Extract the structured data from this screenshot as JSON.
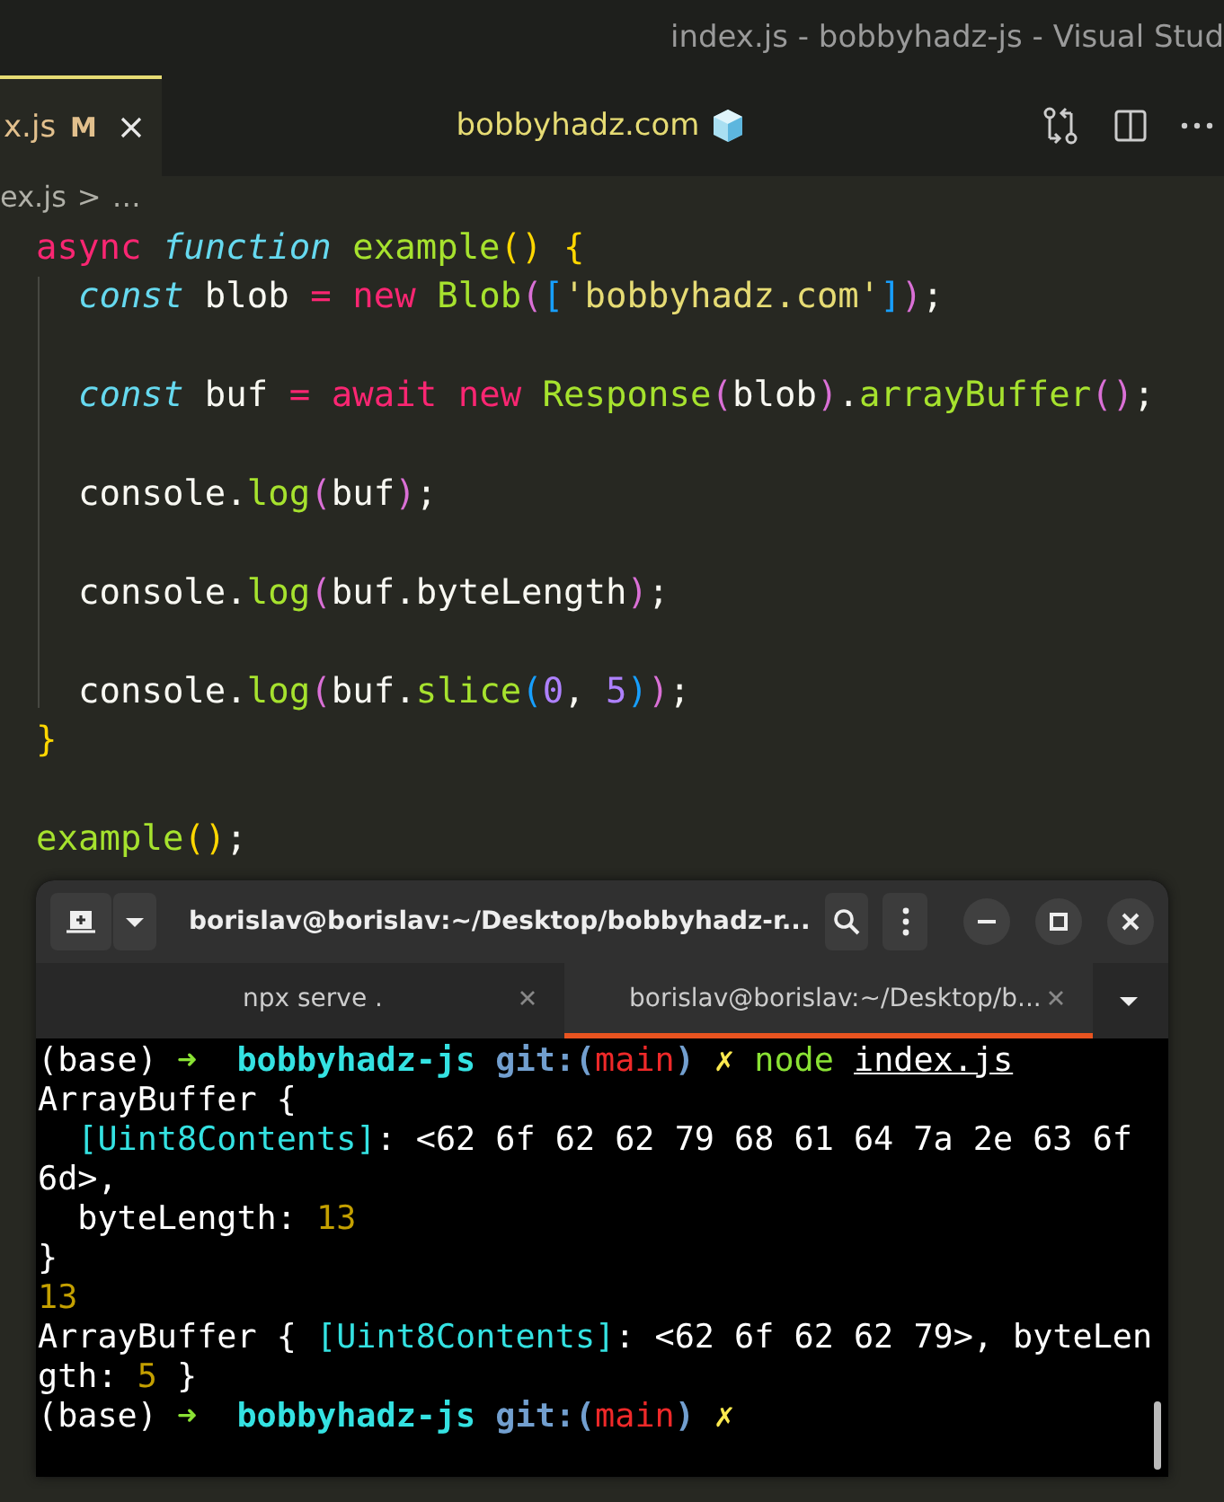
{
  "window": {
    "title": "index.js - bobbyhadz-js - Visual Stud"
  },
  "editor_tabs": [
    {
      "label": "x.js",
      "badge": "M",
      "selected": true
    }
  ],
  "editor_title": {
    "text": "bobbyhadz.com"
  },
  "breadcrumb": {
    "file": "ex.js",
    "separator": ">",
    "rest": "…"
  },
  "code_lines": [
    {
      "spaced": false,
      "tokens": [
        {
          "text": "async",
          "kind": "kw"
        },
        {
          "text": " function",
          "kind": "storage"
        },
        {
          "text": " example",
          "kind": "fn"
        },
        {
          "text": "()",
          "kind": "p1"
        },
        {
          "text": " {",
          "kind": "p1"
        }
      ]
    },
    {
      "spaced": false,
      "tokens": [
        {
          "text": "  const",
          "kind": "storage"
        },
        {
          "text": " blob ",
          "kind": "plain"
        },
        {
          "text": "=",
          "kind": "kw"
        },
        {
          "text": " new",
          "kind": "kw"
        },
        {
          "text": " Blob",
          "kind": "fn"
        },
        {
          "text": "(",
          "kind": "p2"
        },
        {
          "text": "[",
          "kind": "p3"
        },
        {
          "text": "'bobbyhadz.com'",
          "kind": "str"
        },
        {
          "text": "]",
          "kind": "p3"
        },
        {
          "text": ")",
          "kind": "p2"
        },
        {
          "text": ";",
          "kind": "plain"
        }
      ]
    },
    {
      "spaced": true,
      "tokens": [
        {
          "text": "  const",
          "kind": "storage"
        },
        {
          "text": " buf ",
          "kind": "plain"
        },
        {
          "text": "=",
          "kind": "kw"
        },
        {
          "text": " await",
          "kind": "kw"
        },
        {
          "text": " new",
          "kind": "kw"
        },
        {
          "text": " Response",
          "kind": "fn"
        },
        {
          "text": "(",
          "kind": "p2"
        },
        {
          "text": "blob",
          "kind": "plain"
        },
        {
          "text": ")",
          "kind": "p2"
        },
        {
          "text": ".",
          "kind": "plain"
        },
        {
          "text": "arrayBuffer",
          "kind": "fn"
        },
        {
          "text": "()",
          "kind": "p2"
        },
        {
          "text": ";",
          "kind": "plain"
        }
      ]
    },
    {
      "spaced": true,
      "tokens": [
        {
          "text": "  console.",
          "kind": "plain"
        },
        {
          "text": "log",
          "kind": "fn"
        },
        {
          "text": "(",
          "kind": "p2"
        },
        {
          "text": "buf",
          "kind": "plain"
        },
        {
          "text": ")",
          "kind": "p2"
        },
        {
          "text": ";",
          "kind": "plain"
        }
      ]
    },
    {
      "spaced": true,
      "tokens": [
        {
          "text": "  console.",
          "kind": "plain"
        },
        {
          "text": "log",
          "kind": "fn"
        },
        {
          "text": "(",
          "kind": "p2"
        },
        {
          "text": "buf.byteLength",
          "kind": "plain"
        },
        {
          "text": ")",
          "kind": "p2"
        },
        {
          "text": ";",
          "kind": "plain"
        }
      ]
    },
    {
      "spaced": true,
      "tokens": [
        {
          "text": "  console.",
          "kind": "plain"
        },
        {
          "text": "log",
          "kind": "fn"
        },
        {
          "text": "(",
          "kind": "p2"
        },
        {
          "text": "buf.",
          "kind": "plain"
        },
        {
          "text": "slice",
          "kind": "fn"
        },
        {
          "text": "(",
          "kind": "p3"
        },
        {
          "text": "0",
          "kind": "num"
        },
        {
          "text": ", ",
          "kind": "plain"
        },
        {
          "text": "5",
          "kind": "num"
        },
        {
          "text": ")",
          "kind": "p3"
        },
        {
          "text": ")",
          "kind": "p2"
        },
        {
          "text": ";",
          "kind": "plain"
        }
      ]
    },
    {
      "spaced": false,
      "tokens": [
        {
          "text": "}",
          "kind": "p1"
        }
      ]
    },
    {
      "spaced": true,
      "tokens": [
        {
          "text": "example",
          "kind": "fn"
        },
        {
          "text": "()",
          "kind": "p1"
        },
        {
          "text": ";",
          "kind": "plain"
        }
      ]
    }
  ],
  "terminal": {
    "title": "borislav@borislav:~/Desktop/bobbyhadz-r...",
    "tabs": [
      {
        "label": "npx serve .",
        "selected": false
      },
      {
        "label": "borislav@borislav:~/Desktop/b...",
        "selected": true
      }
    ],
    "lines": [
      [
        {
          "text": "(base) ",
          "kind": "plain"
        },
        {
          "text": "➜",
          "kind": "arrow"
        },
        {
          "text": "  bobbyhadz-js",
          "kind": "dir"
        },
        {
          "text": " git:(",
          "kind": "git"
        },
        {
          "text": "main",
          "kind": "branch"
        },
        {
          "text": ")",
          "kind": "git"
        },
        {
          "text": " ✗",
          "kind": "x"
        },
        {
          "text": " node ",
          "kind": "cmd"
        },
        {
          "text": "index.js",
          "kind": "under"
        }
      ],
      [
        {
          "text": "ArrayBuffer {",
          "kind": "plain"
        }
      ],
      [
        {
          "text": "  [Uint8Contents]",
          "kind": "key"
        },
        {
          "text": ": <62 6f 62 62 79 68 61 64 7a 2e 63 6f",
          "kind": "plain"
        }
      ],
      [
        {
          "text": "6d>,",
          "kind": "plain"
        }
      ],
      [
        {
          "text": "  byteLength: ",
          "kind": "plain"
        },
        {
          "text": "13",
          "kind": "num"
        }
      ],
      [
        {
          "text": "}",
          "kind": "plain"
        }
      ],
      [
        {
          "text": "13",
          "kind": "num"
        }
      ],
      [
        {
          "text": "ArrayBuffer { ",
          "kind": "plain"
        },
        {
          "text": "[Uint8Contents]",
          "kind": "key"
        },
        {
          "text": ": <62 6f 62 62 79>, byteLen",
          "kind": "plain"
        }
      ],
      [
        {
          "text": "gth: ",
          "kind": "plain"
        },
        {
          "text": "5",
          "kind": "num"
        },
        {
          "text": " }",
          "kind": "plain"
        }
      ],
      [
        {
          "text": "(base) ",
          "kind": "plain"
        },
        {
          "text": "➜",
          "kind": "arrow"
        },
        {
          "text": "  bobbyhadz-js",
          "kind": "dir"
        },
        {
          "text": " git:(",
          "kind": "git"
        },
        {
          "text": "main",
          "kind": "branch"
        },
        {
          "text": ")",
          "kind": "git"
        },
        {
          "text": " ✗",
          "kind": "x"
        }
      ]
    ]
  }
}
